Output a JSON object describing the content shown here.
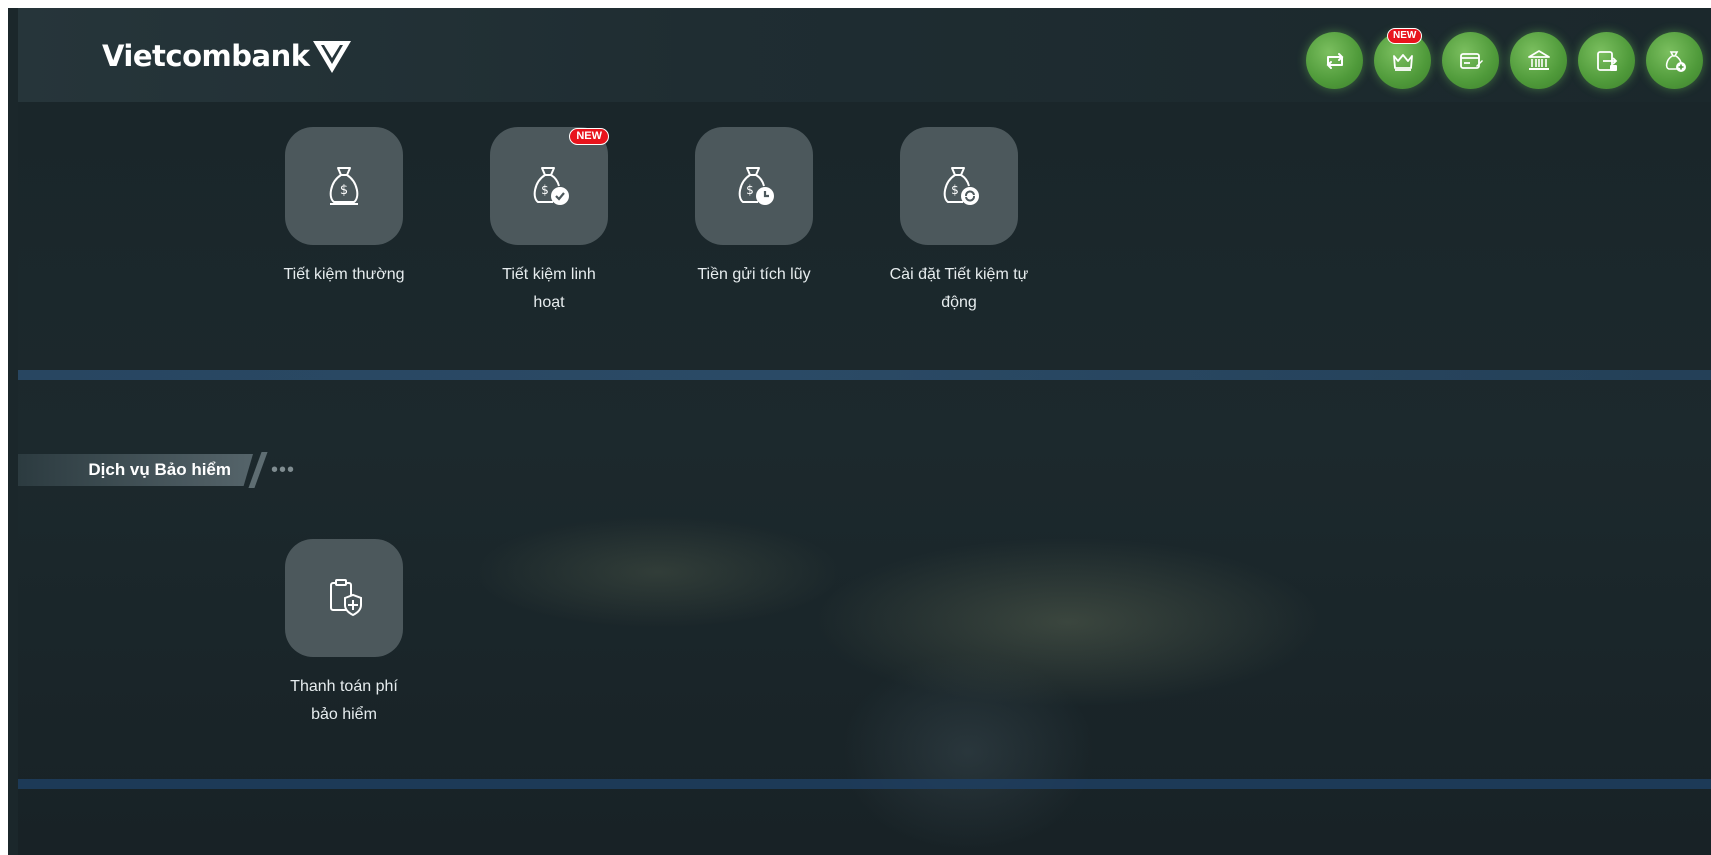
{
  "brand": {
    "name": "Vietcombank"
  },
  "quick_actions": [
    {
      "icon": "transfer-icon",
      "badge": ""
    },
    {
      "icon": "crown-icon",
      "badge": "NEW"
    },
    {
      "icon": "card-payment-icon",
      "badge": ""
    },
    {
      "icon": "bank-icon",
      "badge": ""
    },
    {
      "icon": "phone-transfer-icon",
      "badge": ""
    },
    {
      "icon": "money-bag-add-icon",
      "badge": ""
    }
  ],
  "savings": {
    "tiles": [
      {
        "label": "Tiết kiệm thường",
        "badge": ""
      },
      {
        "label": "Tiết kiệm linh hoạt",
        "badge": "NEW"
      },
      {
        "label": "Tiền gửi tích lũy",
        "badge": ""
      },
      {
        "label": "Cài đặt Tiết kiệm tự động",
        "badge": ""
      }
    ]
  },
  "insurance": {
    "title": "Dịch vụ Bảo hiểm",
    "more": "•••",
    "tiles": [
      {
        "label": "Thanh toán phí bảo hiểm"
      }
    ]
  },
  "colors": {
    "accent_green": "#4f9a3a",
    "badge_red": "#e8131c",
    "background": "#1b272b"
  }
}
